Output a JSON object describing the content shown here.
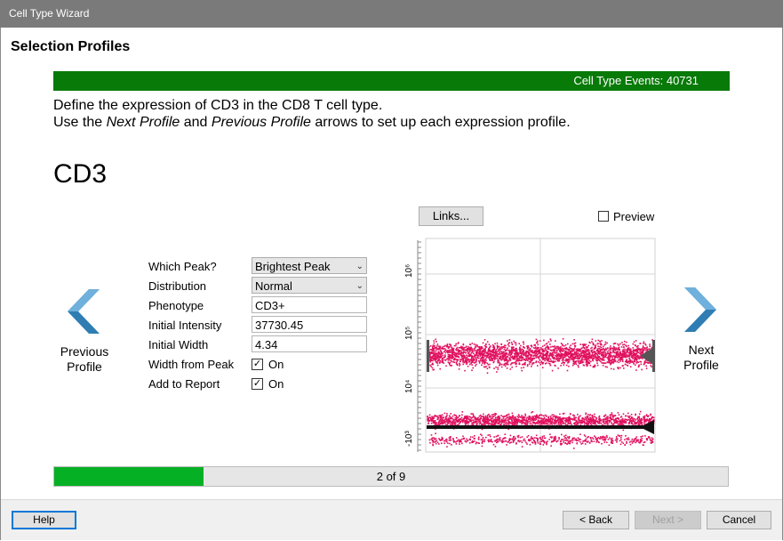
{
  "window": {
    "title": "Cell Type Wizard"
  },
  "section_title": "Selection Profiles",
  "events_bar": {
    "label": "Cell Type Events: 40731",
    "color": "#087a08"
  },
  "instructions": {
    "line1": "Define the expression of CD3 in the CD8 T cell type.",
    "line2_pre": "Use the ",
    "line2_next_profile": "Next Profile",
    "line2_mid": " and ",
    "line2_prev_profile": "Previous Profile",
    "line2_post": " arrows to set up each expression profile."
  },
  "marker_name": "CD3",
  "nav": {
    "previous_label_1": "Previous",
    "previous_label_2": "Profile",
    "next_label_1": "Next",
    "next_label_2": "Profile",
    "arrow_color": "#3a86b8"
  },
  "form": {
    "which_peak_label": "Which Peak?",
    "which_peak_value": "Brightest Peak",
    "distribution_label": "Distribution",
    "distribution_value": "Normal",
    "phenotype_label": "Phenotype",
    "phenotype_value": "CD3+",
    "initial_intensity_label": "Initial Intensity",
    "initial_intensity_value": "37730.45",
    "initial_width_label": "Initial Width",
    "initial_width_value": "4.34",
    "width_from_peak_label": "Width from Peak",
    "width_from_peak_checked": true,
    "width_from_peak_value": "On",
    "add_to_report_label": "Add to Report",
    "add_to_report_checked": true,
    "add_to_report_value": "On"
  },
  "plot_controls": {
    "links_button": "Links...",
    "preview_label": "Preview",
    "preview_checked": false
  },
  "plot": {
    "axis_labels": [
      "10⁶",
      "10⁵",
      "10⁴",
      "-10³"
    ],
    "point_color": "#e0115f"
  },
  "progress": {
    "text": "2 of 9",
    "current": 2,
    "total": 9,
    "color": "#06b025"
  },
  "buttons": {
    "help": "Help",
    "back": "< Back",
    "next": "Next >",
    "cancel": "Cancel"
  }
}
